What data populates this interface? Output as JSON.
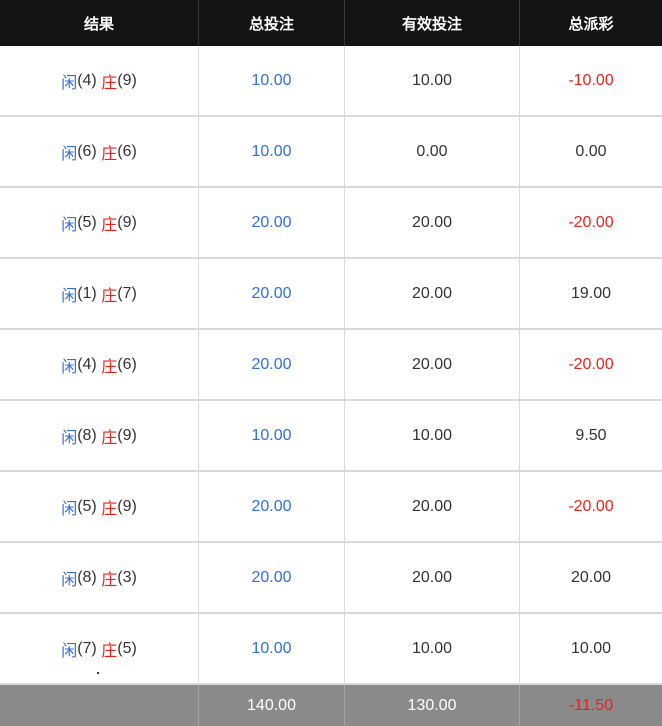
{
  "header": {
    "result": "结果",
    "total_bet": "总投注",
    "valid_bet": "有效投注",
    "total_payout": "总派彩"
  },
  "rows": [
    {
      "player_label": "闲",
      "player_score": "(4)",
      "banker_label": "庄",
      "banker_score": "(9)",
      "total_bet": "10.00",
      "valid_bet": "10.00",
      "payout": "-10.00",
      "payout_color": "#e8231b"
    },
    {
      "player_label": "闲",
      "player_score": "(6)",
      "banker_label": "庄",
      "banker_score": "(6)",
      "total_bet": "10.00",
      "valid_bet": "0.00",
      "payout": "0.00",
      "payout_color": "#333333"
    },
    {
      "player_label": "闲",
      "player_score": "(5)",
      "banker_label": "庄",
      "banker_score": "(9)",
      "total_bet": "20.00",
      "valid_bet": "20.00",
      "payout": "-20.00",
      "payout_color": "#e8231b"
    },
    {
      "player_label": "闲",
      "player_score": "(1)",
      "banker_label": "庄",
      "banker_score": "(7)",
      "total_bet": "20.00",
      "valid_bet": "20.00",
      "payout": "19.00",
      "payout_color": "#333333"
    },
    {
      "player_label": "闲",
      "player_score": "(4)",
      "banker_label": "庄",
      "banker_score": "(6)",
      "total_bet": "20.00",
      "valid_bet": "20.00",
      "payout": "-20.00",
      "payout_color": "#e8231b"
    },
    {
      "player_label": "闲",
      "player_score": "(8)",
      "banker_label": "庄",
      "banker_score": "(9)",
      "total_bet": "10.00",
      "valid_bet": "10.00",
      "payout": "9.50",
      "payout_color": "#333333"
    },
    {
      "player_label": "闲",
      "player_score": "(5)",
      "banker_label": "庄",
      "banker_score": "(9)",
      "total_bet": "20.00",
      "valid_bet": "20.00",
      "payout": "-20.00",
      "payout_color": "#e8231b"
    },
    {
      "player_label": "闲",
      "player_score": "(8)",
      "banker_label": "庄",
      "banker_score": "(3)",
      "total_bet": "20.00",
      "valid_bet": "20.00",
      "payout": "20.00",
      "payout_color": "#333333"
    },
    {
      "player_label": "闲",
      "player_score": "(7)",
      "banker_label": "庄",
      "banker_score": "(5)",
      "total_bet": "10.00",
      "valid_bet": "10.00",
      "payout": "10.00",
      "payout_color": "#333333"
    }
  ],
  "footer": {
    "result": "",
    "total_bet": "140.00",
    "valid_bet": "130.00",
    "total_payout": "-11.50",
    "total_payout_color": "#e8231b"
  },
  "colors": {
    "header_bg": "#141414",
    "footer_bg": "#8a8a8a",
    "player_blue": "#2f6fe0",
    "banker_red": "#e8231b",
    "loss_red": "#e8231b"
  }
}
